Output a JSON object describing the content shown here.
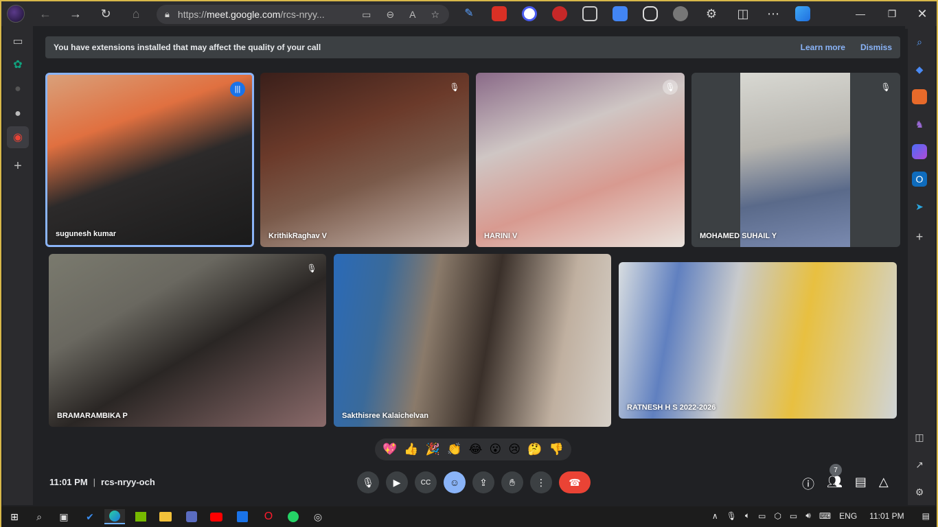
{
  "browser": {
    "url_prefix": "https://",
    "url_domain": "meet.google.com",
    "url_path": "/rcs-nryy..."
  },
  "banner": {
    "message": "You have extensions installed that may affect the quality of your call",
    "learn_more": "Learn more",
    "dismiss": "Dismiss"
  },
  "participants": [
    {
      "name": "sugunesh kumar",
      "state": "speaking"
    },
    {
      "name": "KrithikRaghav V",
      "state": "muted"
    },
    {
      "name": "HARINI V",
      "state": "muted"
    },
    {
      "name": "MOHAMED SUHAIL Y",
      "state": "muted"
    },
    {
      "name": "BRAMARAMBIKA P",
      "state": "muted"
    },
    {
      "name": "Sakthisree Kalaichelvan",
      "state": "unmuted"
    },
    {
      "name": "RATNESH H S 2022-2026",
      "state": "unmuted"
    }
  ],
  "reactions": [
    "💖",
    "👍",
    "🎉",
    "👏",
    "😂",
    "😮",
    "😢",
    "🤔",
    "👎"
  ],
  "meeting": {
    "time": "11:01 PM",
    "code": "rcs-nryy-och",
    "people_count": "7"
  },
  "taskbar": {
    "language": "ENG",
    "clock": "11:01 PM"
  },
  "colors": {
    "speaking_ring": "#8ab4f8",
    "end_call": "#ea4335",
    "link": "#8ab4f8",
    "frame_border": "#d8b84a"
  }
}
